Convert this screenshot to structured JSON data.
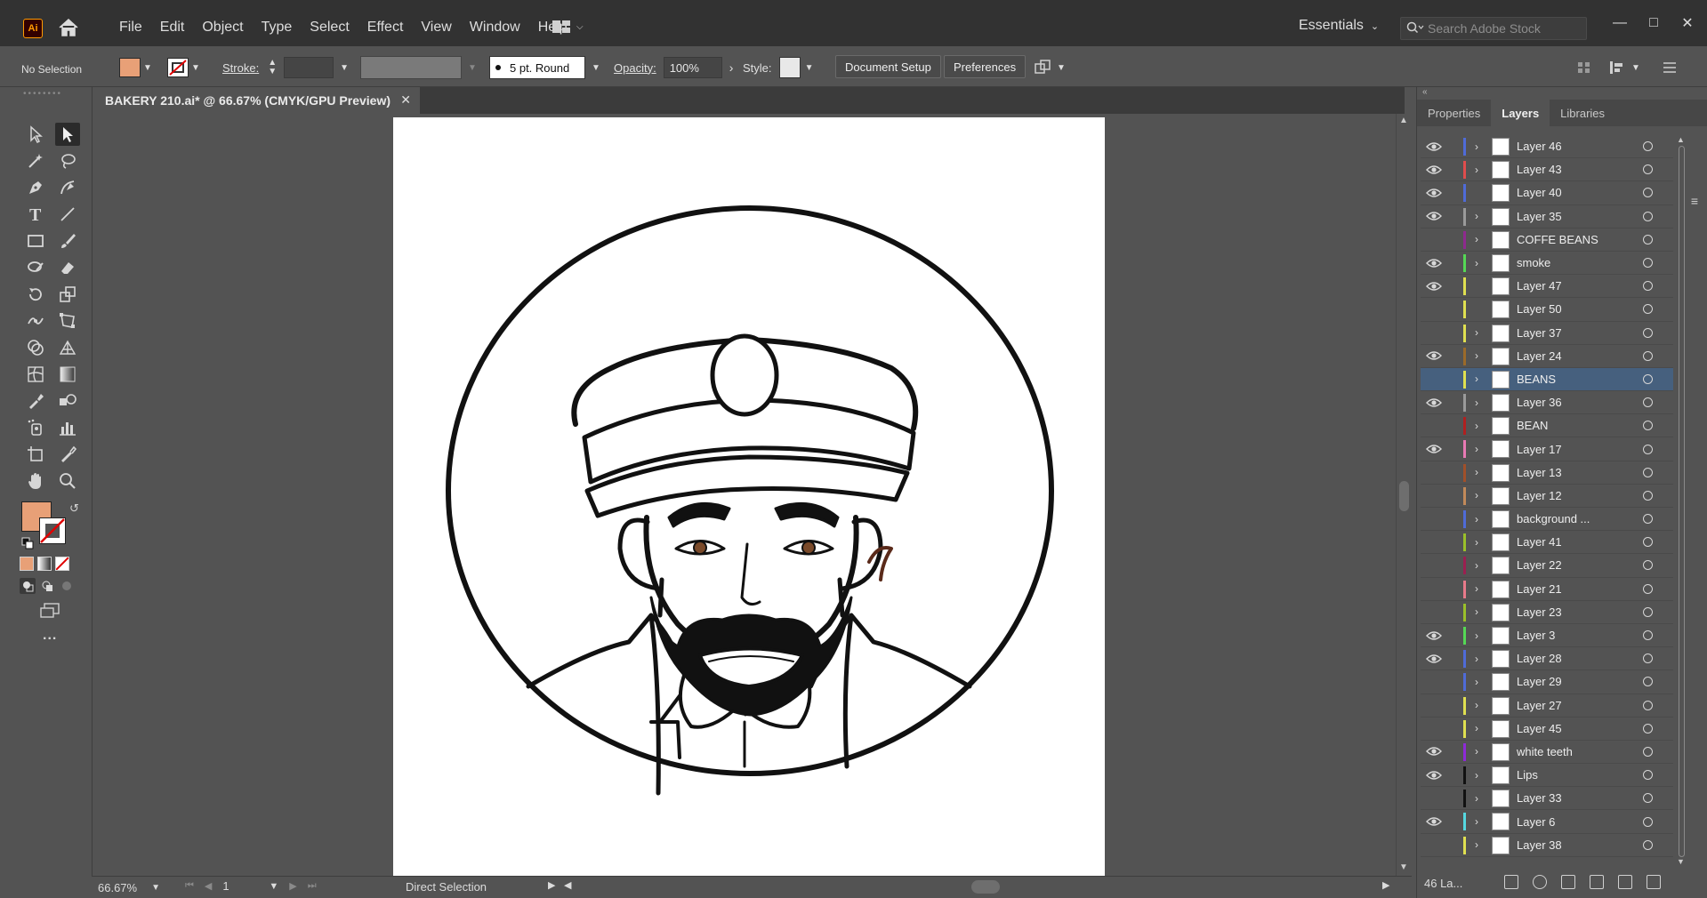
{
  "app": {
    "logo_text": "Ai",
    "menu": [
      "File",
      "Edit",
      "Object",
      "Type",
      "Select",
      "Effect",
      "View",
      "Window",
      "Help"
    ],
    "workspace": "Essentials",
    "stock_search_placeholder": "Search Adobe Stock"
  },
  "control_bar": {
    "selection_label": "No Selection",
    "fill_color": "#e8a077",
    "stroke_label": "Stroke:",
    "brush_label": "5 pt. Round",
    "opacity_label": "Opacity:",
    "opacity_value": "100%",
    "style_label": "Style:",
    "document_setup_label": "Document Setup",
    "preferences_label": "Preferences"
  },
  "document": {
    "tab_title": "BAKERY 210.ai* @ 66.67% (CMYK/GPU Preview)",
    "zoom": "66.67%",
    "artboard_number": "1",
    "status_tool": "Direct Selection"
  },
  "toolbar": {
    "fill_swatch": "#e8a077",
    "more_label": "..."
  },
  "panel": {
    "tabs": [
      "Properties",
      "Layers",
      "Libraries"
    ],
    "active_tab": "Layers",
    "layer_count_label": "46 La...",
    "layers": [
      {
        "name": "Layer 46",
        "visible": true,
        "color": "#4f6bd8",
        "expand": true
      },
      {
        "name": "Layer 43",
        "visible": true,
        "color": "#e04d4d",
        "expand": true
      },
      {
        "name": "Layer 40",
        "visible": true,
        "color": "#4f6bd8",
        "expand": false
      },
      {
        "name": "Layer 35",
        "visible": true,
        "color": "#9a9a9a",
        "expand": true
      },
      {
        "name": "COFFE BEANS",
        "visible": false,
        "color": "#8e2a8e",
        "expand": true
      },
      {
        "name": "smoke",
        "visible": true,
        "color": "#55d855",
        "expand": true
      },
      {
        "name": "Layer 47",
        "visible": true,
        "color": "#e0e050",
        "expand": false
      },
      {
        "name": "Layer 50",
        "visible": false,
        "color": "#e0e050",
        "expand": false
      },
      {
        "name": "Layer 37",
        "visible": false,
        "color": "#e0e050",
        "expand": true
      },
      {
        "name": "Layer 24",
        "visible": true,
        "color": "#9b6a2a",
        "expand": true
      },
      {
        "name": "BEANS",
        "visible": false,
        "color": "#e0e050",
        "expand": true
      },
      {
        "name": "Layer 36",
        "visible": true,
        "color": "#9a9a9a",
        "expand": true
      },
      {
        "name": "BEAN",
        "visible": false,
        "color": "#b02020",
        "expand": true
      },
      {
        "name": "Layer 17",
        "visible": true,
        "color": "#e87ab4",
        "expand": true
      },
      {
        "name": "Layer 13",
        "visible": false,
        "color": "#a0502a",
        "expand": true
      },
      {
        "name": "Layer 12",
        "visible": false,
        "color": "#c28a5a",
        "expand": true
      },
      {
        "name": "background ...",
        "visible": false,
        "color": "#4f6bd8",
        "expand": true
      },
      {
        "name": "Layer 41",
        "visible": false,
        "color": "#9ac02a",
        "expand": true
      },
      {
        "name": "Layer 22",
        "visible": false,
        "color": "#9a2050",
        "expand": true
      },
      {
        "name": "Layer 21",
        "visible": false,
        "color": "#e87a8a",
        "expand": true
      },
      {
        "name": "Layer 23",
        "visible": false,
        "color": "#9ac02a",
        "expand": true
      },
      {
        "name": "Layer 3",
        "visible": true,
        "color": "#55d855",
        "expand": true
      },
      {
        "name": "Layer 28",
        "visible": true,
        "color": "#4f6bd8",
        "expand": true
      },
      {
        "name": "Layer 29",
        "visible": false,
        "color": "#4f6bd8",
        "expand": true
      },
      {
        "name": "Layer 27",
        "visible": false,
        "color": "#e0e050",
        "expand": true
      },
      {
        "name": "Layer 45",
        "visible": false,
        "color": "#e0e050",
        "expand": true
      },
      {
        "name": "white teeth",
        "visible": true,
        "color": "#8e2ad8",
        "expand": true
      },
      {
        "name": "Lips",
        "visible": true,
        "color": "#111111",
        "expand": true
      },
      {
        "name": "Layer 33",
        "visible": false,
        "color": "#111111",
        "expand": true
      },
      {
        "name": "Layer 6",
        "visible": true,
        "color": "#55d8e0",
        "expand": true
      },
      {
        "name": "Layer 38",
        "visible": false,
        "color": "#e0e050",
        "expand": true
      }
    ]
  }
}
